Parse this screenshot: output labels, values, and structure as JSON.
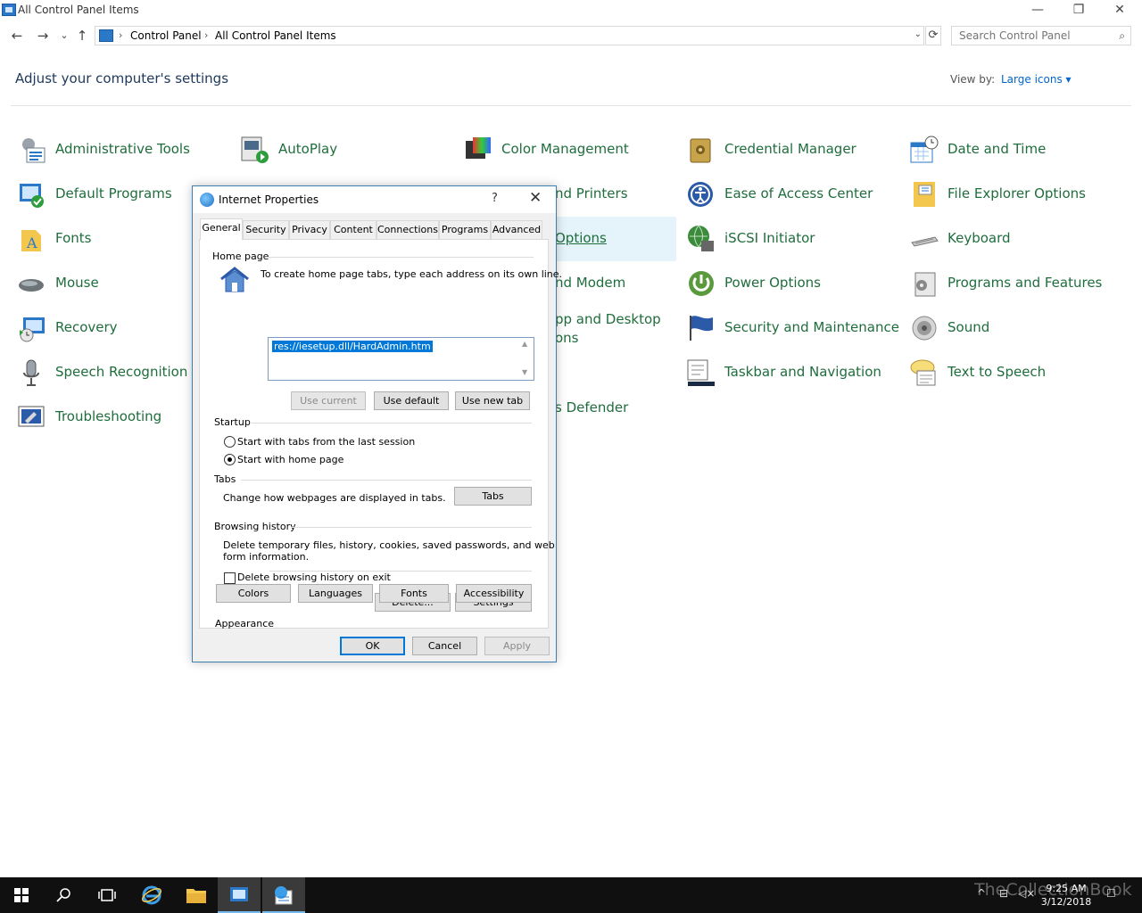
{
  "window": {
    "title": "All Control Panel Items",
    "minimize": "—",
    "restore": "❐",
    "close": "✕"
  },
  "address": {
    "back": "←",
    "forward": "→",
    "recent": "⌄",
    "up": "↑",
    "crumbs": [
      "Control Panel",
      "All Control Panel Items"
    ],
    "separator": "›",
    "search_placeholder": "Search Control Panel"
  },
  "header": {
    "title": "Adjust your computer's settings",
    "view_by_label": "View by:",
    "view_by_value": "Large icons ▾"
  },
  "items": [
    {
      "label": "Administrative Tools",
      "icon": "admin-tools-icon"
    },
    {
      "label": "AutoPlay",
      "icon": "autoplay-icon"
    },
    {
      "label": "Color Management",
      "icon": "color-management-icon"
    },
    {
      "label": "Credential Manager",
      "icon": "credential-manager-icon"
    },
    {
      "label": "Date and Time",
      "icon": "date-time-icon"
    },
    {
      "label": "Default Programs",
      "icon": "default-programs-icon"
    },
    {
      "label": "nd Printers",
      "icon": "devices-printers-icon"
    },
    {
      "label": "Ease of Access Center",
      "icon": "ease-of-access-icon"
    },
    {
      "label": "File Explorer Options",
      "icon": "file-explorer-options-icon"
    },
    {
      "label": "Fonts",
      "icon": "fonts-icon"
    },
    {
      "label": "Options",
      "icon": "internet-options-icon"
    },
    {
      "label": "iSCSI Initiator",
      "icon": "iscsi-initiator-icon"
    },
    {
      "label": "Keyboard",
      "icon": "keyboard-icon"
    },
    {
      "label": "Mouse",
      "icon": "mouse-icon"
    },
    {
      "label": "nd Modem",
      "icon": "phone-modem-icon"
    },
    {
      "label": "Power Options",
      "icon": "power-options-icon"
    },
    {
      "label": "Programs and Features",
      "icon": "programs-features-icon"
    },
    {
      "label": "Recovery",
      "icon": "recovery-icon"
    },
    {
      "label": "pp and Desktop",
      "label2": "ons",
      "icon": "remoteapp-icon"
    },
    {
      "label": "Security and Maintenance",
      "icon": "security-maintenance-icon"
    },
    {
      "label": "Sound",
      "icon": "sound-icon"
    },
    {
      "label": "Speech Recognition",
      "icon": "speech-recognition-icon"
    },
    {
      "label": "Taskbar and Navigation",
      "icon": "taskbar-navigation-icon"
    },
    {
      "label": "Text to Speech",
      "icon": "text-to-speech-icon"
    },
    {
      "label": "Troubleshooting",
      "icon": "troubleshooting-icon"
    },
    {
      "label": "s Defender",
      "icon": "windows-defender-icon"
    }
  ],
  "dialog": {
    "title": "Internet Properties",
    "help": "?",
    "close": "✕",
    "tabs": [
      "General",
      "Security",
      "Privacy",
      "Content",
      "Connections",
      "Programs",
      "Advanced"
    ],
    "home_page": {
      "group": "Home page",
      "hint": "To create home page tabs, type each address on its own line.",
      "value": "res://iesetup.dll/HardAdmin.htm",
      "use_current": "Use current",
      "use_default": "Use default",
      "use_new_tab": "Use new tab"
    },
    "startup": {
      "group": "Startup",
      "option_last_session": "Start with tabs from the last session",
      "option_home_page": "Start with home page"
    },
    "tabs_group": {
      "group": "Tabs",
      "desc": "Change how webpages are displayed in tabs.",
      "button": "Tabs"
    },
    "browsing_history": {
      "group": "Browsing history",
      "desc_line1": "Delete temporary files, history, cookies, saved passwords, and web",
      "desc_line2": "form information.",
      "delete_on_exit": "Delete browsing history on exit",
      "delete_button": "Delete...",
      "settings_button": "Settings"
    },
    "appearance": {
      "group": "Appearance",
      "colors": "Colors",
      "languages": "Languages",
      "fonts": "Fonts",
      "accessibility": "Accessibility"
    },
    "ok": "OK",
    "cancel": "Cancel",
    "apply": "Apply"
  },
  "taskbar": {
    "clock_time": "9:25 AM",
    "clock_date": "3/12/2018",
    "watermark": "TheCollectionBook"
  }
}
